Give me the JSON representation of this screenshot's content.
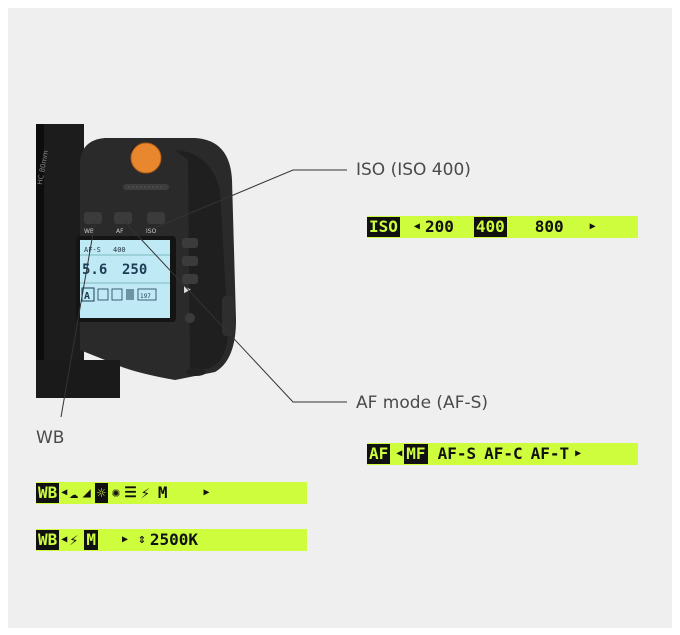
{
  "callouts": {
    "iso": "ISO  (ISO 400)",
    "af": "AF mode  (AF-S)",
    "wb": "WB"
  },
  "camera_display": {
    "aperture": "5.6",
    "shutter": "250",
    "mode": "A",
    "wb_setting": "AF-S",
    "iso_value": "400",
    "shots": "197",
    "buttons": {
      "iso": "ISO",
      "af": "AF",
      "wb": "WB"
    }
  },
  "iso_bar": {
    "tag": "ISO",
    "values": [
      "200",
      "400",
      "800"
    ],
    "selected": "400"
  },
  "af_bar": {
    "tag": "AF",
    "values": [
      "MF",
      "AF-S",
      "AF-C",
      "AF-T"
    ],
    "selected": "MF"
  },
  "wb_bar": {
    "tag": "WB",
    "options": [
      "cloudy",
      "shade",
      "daylight",
      "tungsten",
      "fluorescent",
      "flash",
      "M"
    ],
    "selected": "daylight",
    "manual": "M"
  },
  "wb_kelvin_bar": {
    "tag": "WB",
    "options": [
      "flash",
      "M"
    ],
    "selected": "M",
    "kelvin": "2500K"
  },
  "colors": {
    "lcd": "#cdfd3d",
    "knob": "#e8872e",
    "screen": "#bfeaf5"
  }
}
